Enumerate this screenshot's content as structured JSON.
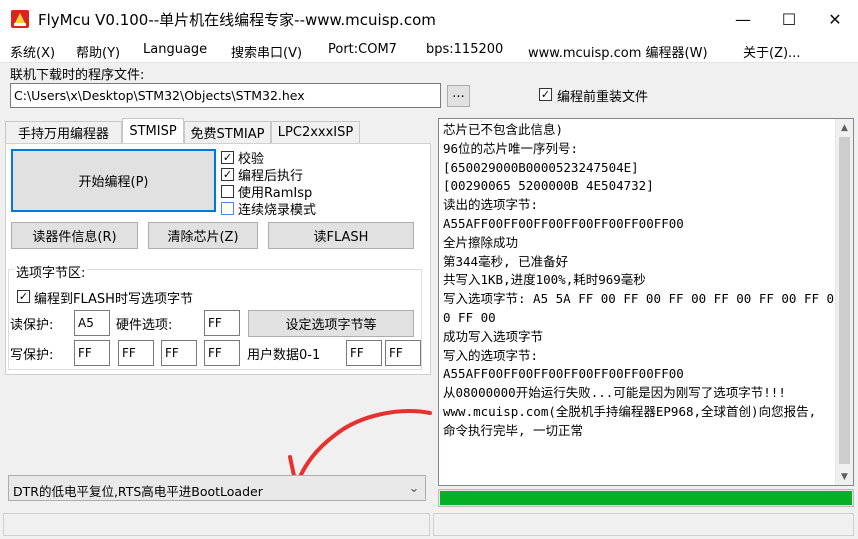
{
  "window": {
    "title": "FlyMcu V0.100--单片机在线编程专家--www.mcuisp.com",
    "minimize": "—",
    "maximize": "☐",
    "close": "✕"
  },
  "menu": [
    "系统(X)",
    "帮助(Y)",
    "Language",
    "搜索串口(V)",
    "Port:COM7",
    "bps:115200",
    "www.mcuisp.com 编程器(W)",
    "关于(Z)..."
  ],
  "file": {
    "label": "联机下载时的程序文件:",
    "path": "C:\\Users\\x\\Desktop\\STM32\\Objects\\STM32.hex",
    "browse": "...",
    "reload_label": "编程前重装文件",
    "reload_checked": "✓"
  },
  "tabs": [
    "手持万用编程器",
    "STMISP",
    "免费STMIAP",
    "LPC2xxxISP"
  ],
  "stmisp": {
    "start_button": "开始编程(P)",
    "options": [
      {
        "label": "校验",
        "mark": "✓"
      },
      {
        "label": "编程后执行",
        "mark": "✓"
      },
      {
        "label": "使用RamIsp",
        "mark": ""
      },
      {
        "label": "连续烧录模式",
        "mark": ""
      }
    ],
    "read_info": "读器件信息(R)",
    "erase_chip": "清除芯片(Z)",
    "read_flash": "读FLASH"
  },
  "option_bytes": {
    "group_label": "选项字节区:",
    "write_to_flash_label": "编程到FLASH时写选项字节",
    "write_to_flash_mark": "✓",
    "read_protect_label": "读保护:",
    "read_protect_value": "A5",
    "hardware_label": "硬件选项:",
    "hardware_value": "FF",
    "set_button": "设定选项字节等",
    "write_protect_label": "写保护:",
    "write_protect_values": [
      "FF",
      "FF",
      "FF",
      "FF"
    ],
    "user_data_label": "用户数据0-1",
    "user_data_values": [
      "FF",
      "FF"
    ]
  },
  "boot_mode": {
    "selected": "DTR的低电平复位,RTS高电平进BootLoader",
    "arrow_glyph": "⌄"
  },
  "log": {
    "lines": [
      "芯片已不包含此信息)",
      "96位的芯片唯一序列号:",
      "[650029000B0000523247504E]",
      "[00290065 5200000B 4E504732]",
      "读出的选项字节:",
      "A55AFF00FF00FF00FF00FF00FF00FF00",
      "全片擦除成功",
      "第344毫秒, 已准备好",
      "共写入1KB,进度100%,耗时969毫秒",
      "写入选项字节: A5 5A FF 00 FF 00 FF 00 FF 00 FF 00 FF 00 FF 00",
      "成功写入选项字节",
      "写入的选项字节:",
      "A55AFF00FF00FF00FF00FF00FF00FF00",
      "从08000000开始运行失败...可能是因为刚写了选项字节!!!",
      "www.mcuisp.com(全脱机手持编程器EP968,全球首创)向您报告, 命令执行完毕, 一切正常"
    ]
  },
  "progress": {
    "value": 1.0
  },
  "colors": {
    "progress": "#06b025",
    "arrow": "#e8302e",
    "checkbox_blue": "#4a8ae8"
  }
}
